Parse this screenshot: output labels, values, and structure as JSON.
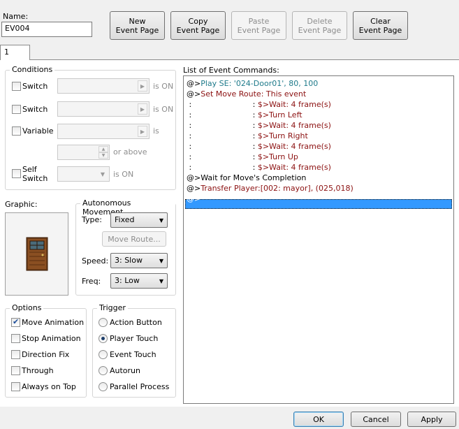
{
  "name_label": "Name:",
  "name_value": "EV004",
  "toolbar": {
    "new_line1": "New",
    "new_line2": "Event Page",
    "copy_line1": "Copy",
    "copy_line2": "Event Page",
    "paste_line1": "Paste",
    "paste_line2": "Event Page",
    "delete_line1": "Delete",
    "delete_line2": "Event Page",
    "clear_line1": "Clear",
    "clear_line2": "Event Page"
  },
  "tab_label": "1",
  "conditions": {
    "title": "Conditions",
    "switch1_label": "Switch",
    "switch1_suffix": "is ON",
    "switch2_label": "Switch",
    "switch2_suffix": "is ON",
    "variable_label": "Variable",
    "variable_suffix": "is",
    "or_above": "or above",
    "self_switch_line1": "Self",
    "self_switch_line2": "Switch",
    "self_switch_suffix": "is ON"
  },
  "graphic_label": "Graphic:",
  "autonomous": {
    "title": "Autonomous Movement",
    "type_label": "Type:",
    "type_value": "Fixed",
    "move_route_button": "Move Route...",
    "speed_label": "Speed:",
    "speed_value": "3: Slow",
    "freq_label": "Freq:",
    "freq_value": "3: Low"
  },
  "options": {
    "title": "Options",
    "items": [
      {
        "label": "Move Animation",
        "checked": true
      },
      {
        "label": "Stop Animation",
        "checked": false
      },
      {
        "label": "Direction Fix",
        "checked": false
      },
      {
        "label": "Through",
        "checked": false
      },
      {
        "label": "Always on Top",
        "checked": false
      }
    ]
  },
  "trigger": {
    "title": "Trigger",
    "items": [
      {
        "label": "Action Button",
        "selected": false
      },
      {
        "label": "Player Touch",
        "selected": true
      },
      {
        "label": "Event Touch",
        "selected": false
      },
      {
        "label": "Autorun",
        "selected": false
      },
      {
        "label": "Parallel Process",
        "selected": false
      }
    ]
  },
  "commands": {
    "title": "List of Event Commands:",
    "lines": [
      {
        "prefix": "@>",
        "text": "Play SE: '024-Door01', 80, 100",
        "color": "blue"
      },
      {
        "prefix": "@>",
        "text": "Set Move Route: This event",
        "color": "red"
      },
      {
        "prefix": " :                         : ",
        "text": "$>Wait: 4 frame(s)",
        "color": "red"
      },
      {
        "prefix": " :                         : ",
        "text": "$>Turn Left",
        "color": "red"
      },
      {
        "prefix": " :                         : ",
        "text": "$>Wait: 4 frame(s)",
        "color": "red"
      },
      {
        "prefix": " :                         : ",
        "text": "$>Turn Right",
        "color": "red"
      },
      {
        "prefix": " :                         : ",
        "text": "$>Wait: 4 frame(s)",
        "color": "red"
      },
      {
        "prefix": " :                         : ",
        "text": "$>Turn Up",
        "color": "red"
      },
      {
        "prefix": " :                         : ",
        "text": "$>Wait: 4 frame(s)",
        "color": "red"
      },
      {
        "prefix": "@>",
        "text": "Wait for Move's Completion",
        "color": "black"
      },
      {
        "prefix": "@>",
        "text": "Transfer Player:[002: mayor], (025,018)",
        "color": "red"
      },
      {
        "prefix": "@>",
        "text": "",
        "color": "selected"
      }
    ]
  },
  "footer": {
    "ok": "OK",
    "cancel": "Cancel",
    "apply": "Apply"
  }
}
